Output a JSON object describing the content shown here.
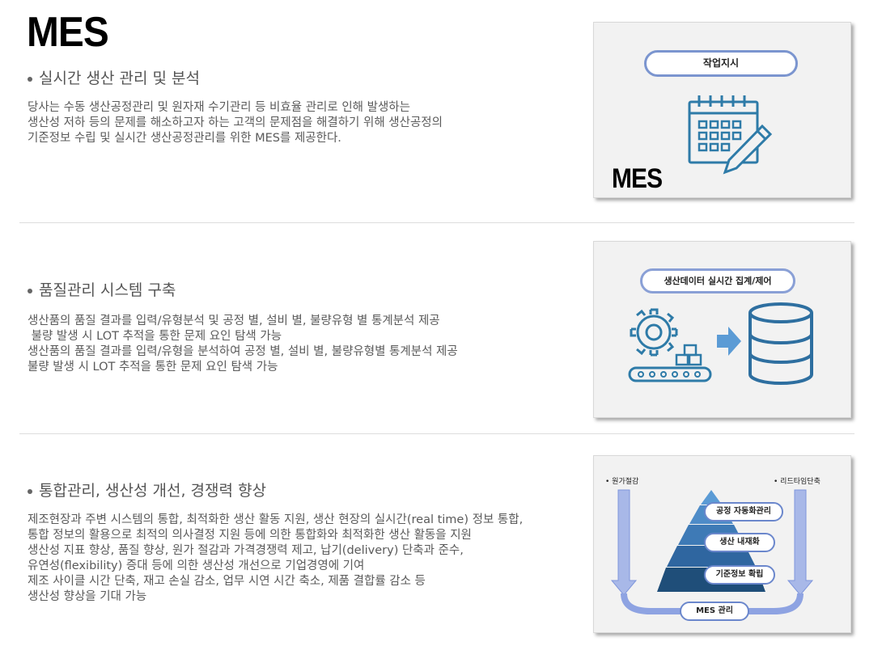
{
  "page": {
    "title": "MES"
  },
  "sections": [
    {
      "title": "실시간 생산 관리 및 분석",
      "lines": [
        "당사는 수동 생산공정관리 및 원자재 수기관리 등 비효율 관리로 인해 발생하는",
        "생산성 저하 등의 문제를 해소하고자 하는 고객의 문제점을 해결하기 위해 생산공정의",
        "기준정보 수립 및 실시간 생산공정관리를 위한 MES를 제공한다."
      ],
      "panel": {
        "pill_label": "작업지시",
        "logo_text": "MES",
        "icon": "calendar-edit-icon"
      }
    },
    {
      "title": "품질관리 시스템 구축",
      "lines": [
        "생산품의 품질 결과를 입력/유형분석 및 공정 별, 설비 별, 불량유형 별 통계분석 제공",
        " 불량 발생 시 LOT 추적을 통한 문제 요인 탐색 가능",
        "생산품의 품질 결과를 입력/유형을 분석하여 공정 별, 설비 별, 불량유형별 통계분석 제공",
        "불량 발생 시 LOT 추적을 통한 문제 요인 탐색 가능"
      ],
      "panel": {
        "pill_label": "생산데이터 실시간 집계/제어",
        "icons": [
          "gear-conveyor-icon",
          "arrow-right-icon",
          "database-icon"
        ]
      }
    },
    {
      "title": "통합관리, 생산성 개선, 경쟁력 향상",
      "lines": [
        "제조현장과 주변 시스템의 통합, 최적화한 생산 활동 지원, 생산 현장의 실시간(real time) 정보 통합,",
        "통합 정보의 활용으로 최적의 의사결정 지원 등에 의한 통합화와 최적화한 생산 활동을 지원",
        "생산성 지표 향상, 품질 향상, 원가 절감과 가격경쟁력 제고, 납기(delivery) 단축과 준수,",
        "유연성(flexibility) 증대 등에 의한 생산성 개선으로 기업경영에 기여",
        "제조 사이클 시간 단축, 재고 손실 감소, 업무 시연 시간 축소, 제품 결합률 감소 등",
        "생산성 향상을 기대 가능"
      ],
      "panel": {
        "left_label": "• 원가절감",
        "right_label": "• 리드타임단축",
        "levels": [
          "공정 자동화관리",
          "생산 내재화",
          "기준정보 확립"
        ],
        "bottom_label": "MES 관리"
      }
    }
  ],
  "colors": {
    "accent": "#2e6fa0",
    "pill_border": "#7b95cf",
    "pyramid_dark": "#1f4e79",
    "pyramid_light": "#5b9bd5"
  }
}
